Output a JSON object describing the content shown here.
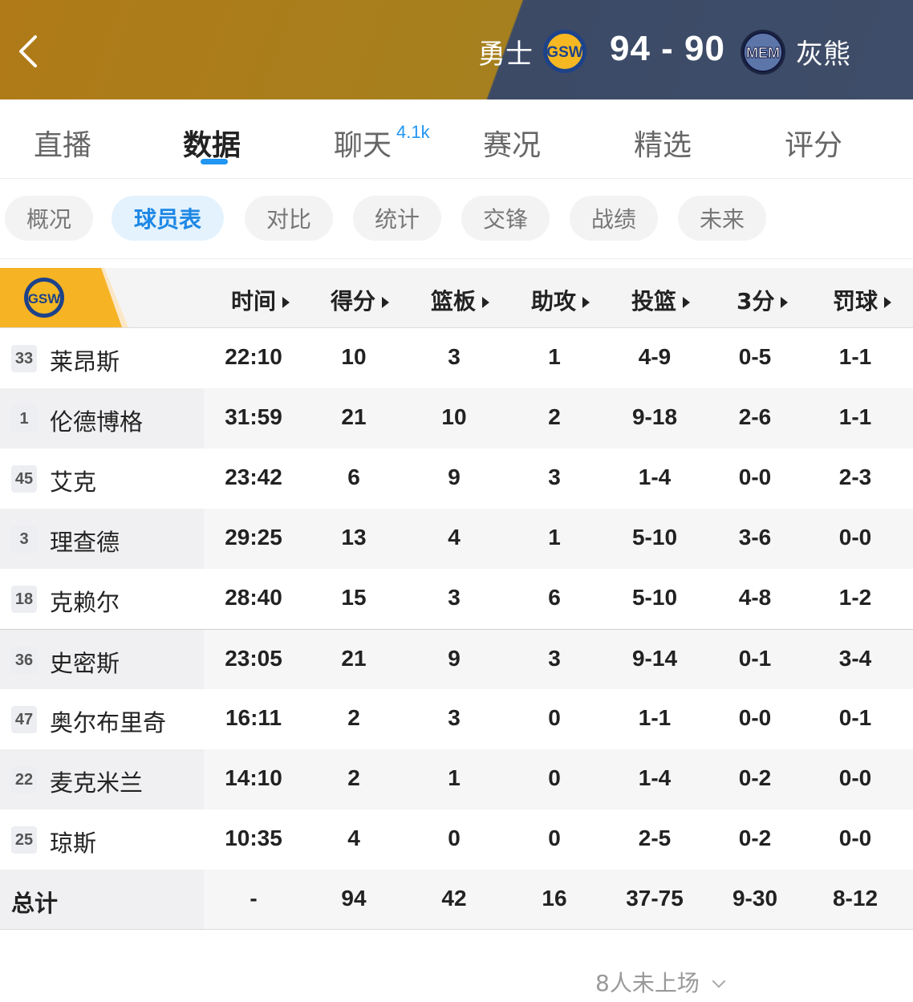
{
  "header": {
    "home_team": "勇士",
    "home_logo_text": "GSW",
    "score": "94 - 90",
    "away_logo_text": "MEM",
    "away_team": "灰熊"
  },
  "tabs": [
    {
      "label": "直播"
    },
    {
      "label": "数据"
    },
    {
      "label": "聊天",
      "badge": "4.1k"
    },
    {
      "label": "赛况"
    },
    {
      "label": "精选"
    },
    {
      "label": "评分"
    }
  ],
  "subtabs": [
    {
      "label": "概况"
    },
    {
      "label": "球员表"
    },
    {
      "label": "对比"
    },
    {
      "label": "统计"
    },
    {
      "label": "交锋"
    },
    {
      "label": "战绩"
    },
    {
      "label": "未来"
    }
  ],
  "table": {
    "team_logo_text": "GSW",
    "columns": [
      "时间",
      "得分",
      "篮板",
      "助攻",
      "投篮",
      "3分",
      "罚球"
    ],
    "rows": [
      {
        "num": "33",
        "name": "莱昂斯",
        "stats": [
          "22:10",
          "10",
          "3",
          "1",
          "4-9",
          "0-5",
          "1-1"
        ]
      },
      {
        "num": "1",
        "name": "伦德博格",
        "stats": [
          "31:59",
          "21",
          "10",
          "2",
          "9-18",
          "2-6",
          "1-1"
        ]
      },
      {
        "num": "45",
        "name": "艾克",
        "stats": [
          "23:42",
          "6",
          "9",
          "3",
          "1-4",
          "0-0",
          "2-3"
        ]
      },
      {
        "num": "3",
        "name": "理查德",
        "stats": [
          "29:25",
          "13",
          "4",
          "1",
          "5-10",
          "3-6",
          "0-0"
        ]
      },
      {
        "num": "18",
        "name": "克赖尔",
        "stats": [
          "28:40",
          "15",
          "3",
          "6",
          "5-10",
          "4-8",
          "1-2"
        ]
      },
      {
        "num": "36",
        "name": "史密斯",
        "stats": [
          "23:05",
          "21",
          "9",
          "3",
          "9-14",
          "0-1",
          "3-4"
        ]
      },
      {
        "num": "47",
        "name": "奥尔布里奇",
        "stats": [
          "16:11",
          "2",
          "3",
          "0",
          "1-1",
          "0-0",
          "0-1"
        ]
      },
      {
        "num": "22",
        "name": "麦克米兰",
        "stats": [
          "14:10",
          "2",
          "1",
          "0",
          "1-4",
          "0-2",
          "0-0"
        ]
      },
      {
        "num": "25",
        "name": "琼斯",
        "stats": [
          "10:35",
          "4",
          "0",
          "0",
          "2-5",
          "0-2",
          "0-0"
        ]
      }
    ],
    "total": {
      "label": "总计",
      "stats": [
        "-",
        "94",
        "42",
        "16",
        "37-75",
        "9-30",
        "8-12"
      ]
    }
  },
  "footer": {
    "dnp_label": "8人未上场"
  },
  "colors": {
    "accent": "#2196f3",
    "home_gold": "#b07a18",
    "away_navy": "#3c4a66",
    "flag_yellow": "#f6b324"
  }
}
